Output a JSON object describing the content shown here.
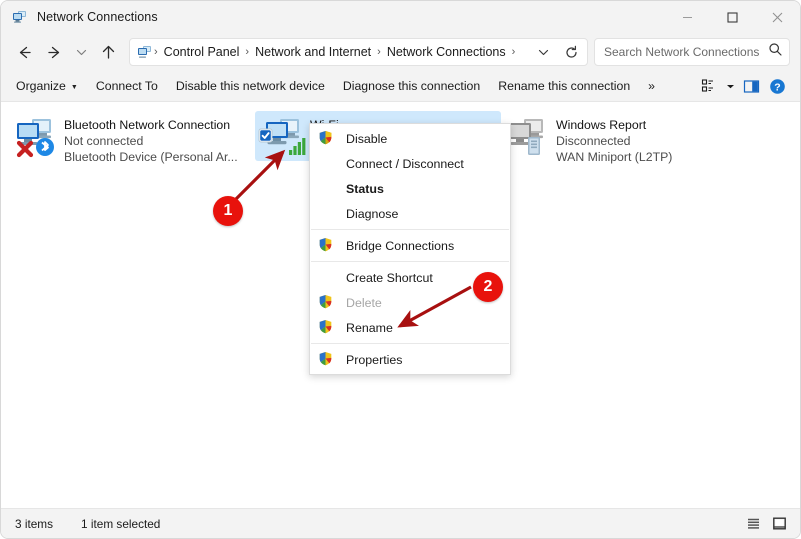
{
  "window": {
    "title": "Network Connections",
    "icon": "network-connections-icon",
    "controls": {
      "minimize": "minimize-icon",
      "maximize": "maximize-icon",
      "close": "close-icon"
    }
  },
  "nav": {
    "back": "back-arrow-icon",
    "forward": "forward-arrow-icon",
    "recent": "chevron-down-icon",
    "up": "up-arrow-icon",
    "refresh": "refresh-icon",
    "address_chevron": "chevron-down-icon",
    "breadcrumbs": [
      "Control Panel",
      "Network and Internet",
      "Network Connections"
    ],
    "separator": "›"
  },
  "search": {
    "placeholder": "Search Network Connections",
    "value": "",
    "icon": "search-icon"
  },
  "toolbar": {
    "items": [
      {
        "label": "Organize",
        "has_caret": true
      },
      {
        "label": "Connect To",
        "has_caret": false
      },
      {
        "label": "Disable this network device",
        "has_caret": false
      },
      {
        "label": "Diagnose this connection",
        "has_caret": false
      },
      {
        "label": "Rename this connection",
        "has_caret": false
      },
      {
        "label": "»",
        "has_caret": false
      }
    ],
    "view_icon": "view-layout-icon",
    "view_caret": "chevron-down-icon",
    "preview_pane_icon": "preview-pane-icon",
    "help_icon": "help-icon"
  },
  "connections": [
    {
      "name": "Bluetooth Network Connection",
      "status": "Not connected",
      "device": "Bluetooth Device (Personal Ar...",
      "selected": false,
      "icon": "bluetooth-network-icon",
      "overlay": "red-x-icon"
    },
    {
      "name": "Wi-Fi",
      "status": "",
      "device": "",
      "selected": true,
      "icon": "wifi-network-icon",
      "overlay": "signal-bars-icon"
    },
    {
      "name": "Windows Report",
      "status": "Disconnected",
      "device": "WAN Miniport (L2TP)",
      "selected": false,
      "icon": "wan-miniport-icon",
      "overlay": ""
    }
  ],
  "context_menu": {
    "items": [
      {
        "label": "Disable",
        "icon": "shield-icon",
        "bold": false,
        "disabled": false,
        "separator_after": false
      },
      {
        "label": "Connect / Disconnect",
        "icon": "",
        "bold": false,
        "disabled": false,
        "separator_after": false
      },
      {
        "label": "Status",
        "icon": "",
        "bold": true,
        "disabled": false,
        "separator_after": false
      },
      {
        "label": "Diagnose",
        "icon": "",
        "bold": false,
        "disabled": false,
        "separator_after": true
      },
      {
        "label": "Bridge Connections",
        "icon": "shield-icon",
        "bold": false,
        "disabled": false,
        "separator_after": true
      },
      {
        "label": "Create Shortcut",
        "icon": "",
        "bold": false,
        "disabled": false,
        "separator_after": false
      },
      {
        "label": "Delete",
        "icon": "shield-icon",
        "bold": false,
        "disabled": true,
        "separator_after": false
      },
      {
        "label": "Rename",
        "icon": "shield-icon",
        "bold": false,
        "disabled": false,
        "separator_after": true
      },
      {
        "label": "Properties",
        "icon": "shield-icon",
        "bold": false,
        "disabled": false,
        "separator_after": false
      }
    ]
  },
  "annotations": [
    {
      "number": "1",
      "color": "#e8120c",
      "points_to": "wifi-connection-item"
    },
    {
      "number": "2",
      "color": "#e8120c",
      "points_to": "menu-item-properties"
    }
  ],
  "statusbar": {
    "item_count": "3 items",
    "selection": "1 item selected",
    "details_view_icon": "details-view-icon",
    "icons_view_icon": "large-icons-view-icon"
  }
}
